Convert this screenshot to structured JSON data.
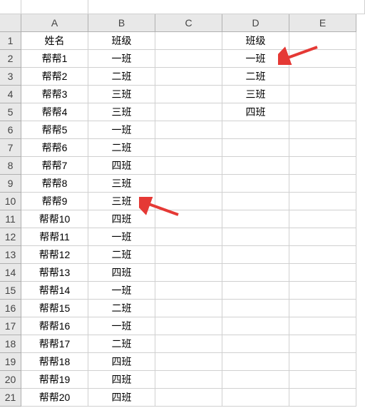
{
  "columns": [
    "A",
    "B",
    "C",
    "D",
    "E"
  ],
  "rowCount": 21,
  "cells": {
    "1": {
      "A": "姓名",
      "B": "班级",
      "C": "",
      "D": "班级",
      "E": ""
    },
    "2": {
      "A": "帮帮1",
      "B": "一班",
      "C": "",
      "D": "一班",
      "E": ""
    },
    "3": {
      "A": "帮帮2",
      "B": "二班",
      "C": "",
      "D": "二班",
      "E": ""
    },
    "4": {
      "A": "帮帮3",
      "B": "三班",
      "C": "",
      "D": "三班",
      "E": ""
    },
    "5": {
      "A": "帮帮4",
      "B": "三班",
      "C": "",
      "D": "四班",
      "E": ""
    },
    "6": {
      "A": "帮帮5",
      "B": "一班",
      "C": "",
      "D": "",
      "E": ""
    },
    "7": {
      "A": "帮帮6",
      "B": "二班",
      "C": "",
      "D": "",
      "E": ""
    },
    "8": {
      "A": "帮帮7",
      "B": "四班",
      "C": "",
      "D": "",
      "E": ""
    },
    "9": {
      "A": "帮帮8",
      "B": "三班",
      "C": "",
      "D": "",
      "E": ""
    },
    "10": {
      "A": "帮帮9",
      "B": "三班",
      "C": "",
      "D": "",
      "E": ""
    },
    "11": {
      "A": "帮帮10",
      "B": "四班",
      "C": "",
      "D": "",
      "E": ""
    },
    "12": {
      "A": "帮帮11",
      "B": "一班",
      "C": "",
      "D": "",
      "E": ""
    },
    "13": {
      "A": "帮帮12",
      "B": "二班",
      "C": "",
      "D": "",
      "E": ""
    },
    "14": {
      "A": "帮帮13",
      "B": "四班",
      "C": "",
      "D": "",
      "E": ""
    },
    "15": {
      "A": "帮帮14",
      "B": "一班",
      "C": "",
      "D": "",
      "E": ""
    },
    "16": {
      "A": "帮帮15",
      "B": "二班",
      "C": "",
      "D": "",
      "E": ""
    },
    "17": {
      "A": "帮帮16",
      "B": "一班",
      "C": "",
      "D": "",
      "E": ""
    },
    "18": {
      "A": "帮帮17",
      "B": "二班",
      "C": "",
      "D": "",
      "E": ""
    },
    "19": {
      "A": "帮帮18",
      "B": "四班",
      "C": "",
      "D": "",
      "E": ""
    },
    "20": {
      "A": "帮帮19",
      "B": "四班",
      "C": "",
      "D": "",
      "E": ""
    },
    "21": {
      "A": "帮帮20",
      "B": "四班",
      "C": "",
      "D": "",
      "E": ""
    }
  },
  "annotations": {
    "arrow1_target": "D2",
    "arrow2_target": "B10"
  }
}
